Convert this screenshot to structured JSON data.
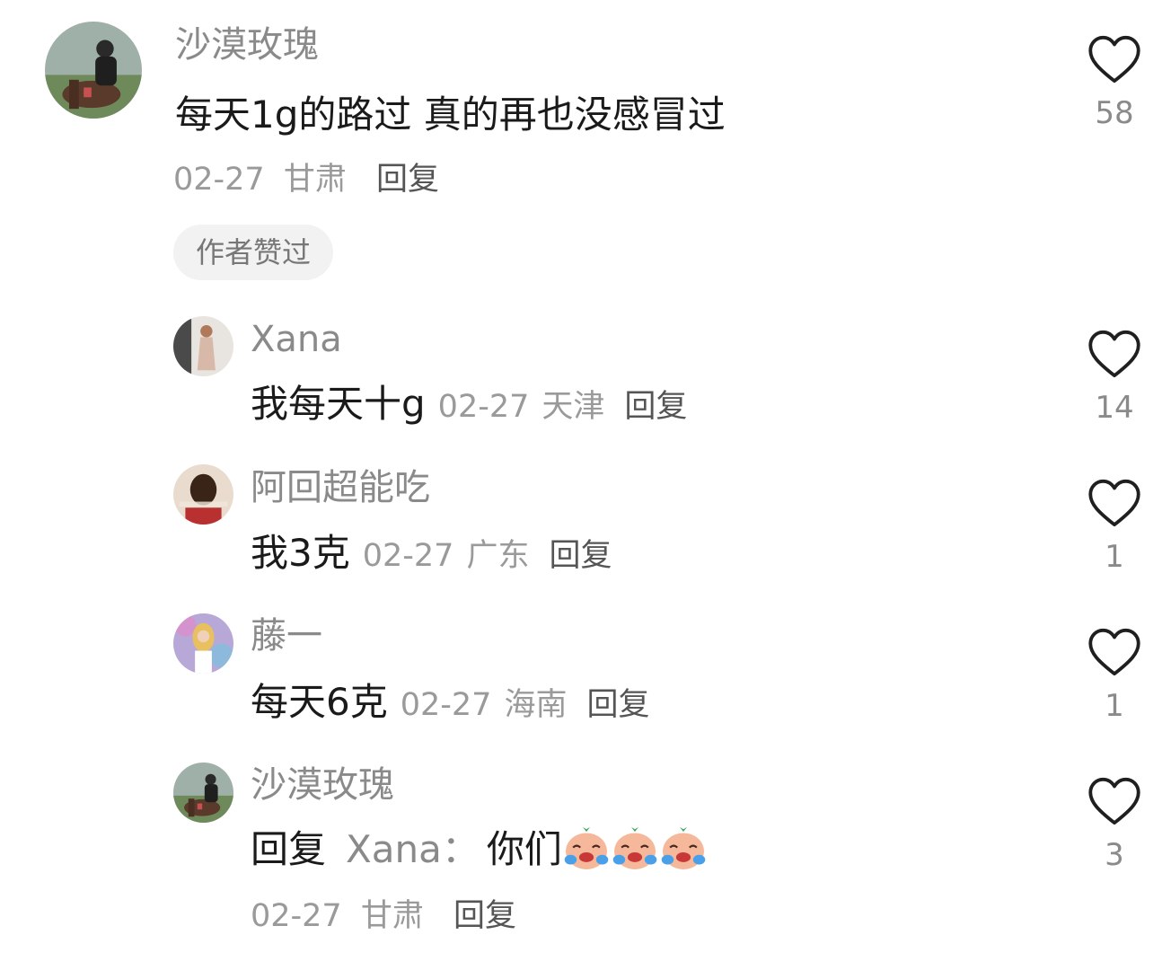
{
  "comments": [
    {
      "username": "沙漠玫瑰",
      "avatar_icon": "avatar-horse-rider",
      "text": "每天1g的路过 真的再也没感冒过",
      "date": "02-27",
      "location": "甘肃",
      "reply_label": "回复",
      "badge": "作者赞过",
      "likes": "58",
      "replies": [
        {
          "username": "Xana",
          "avatar_icon": "avatar-woman-standing",
          "text": "我每天十g",
          "date": "02-27",
          "location": "天津",
          "reply_label": "回复",
          "likes": "14"
        },
        {
          "username": "阿回超能吃",
          "avatar_icon": "avatar-person-portrait",
          "text": "我3克",
          "date": "02-27",
          "location": "广东",
          "reply_label": "回复",
          "likes": "1"
        },
        {
          "username": "藤一",
          "avatar_icon": "avatar-colorful-figure",
          "text": "每天6克",
          "date": "02-27",
          "location": "海南",
          "reply_label": "回复",
          "likes": "1"
        },
        {
          "username": "沙漠玫瑰",
          "avatar_icon": "avatar-horse-rider",
          "reply_prefix": "回复",
          "reply_target": "Xana：",
          "text": "你们",
          "emoji": "crying-laughing-emoji",
          "emoji_count": 3,
          "date": "02-27",
          "location": "甘肃",
          "reply_label": "回复",
          "likes": "3"
        }
      ]
    }
  ],
  "colors": {
    "username": "#8a8a8a",
    "content": "#1a1a1a",
    "meta": "#9a9a9a",
    "reply_link": "#555555",
    "badge_bg": "#f2f2f2",
    "heart_stroke": "#1f1f1f"
  },
  "icons": {
    "like": "heart-outline-icon"
  }
}
